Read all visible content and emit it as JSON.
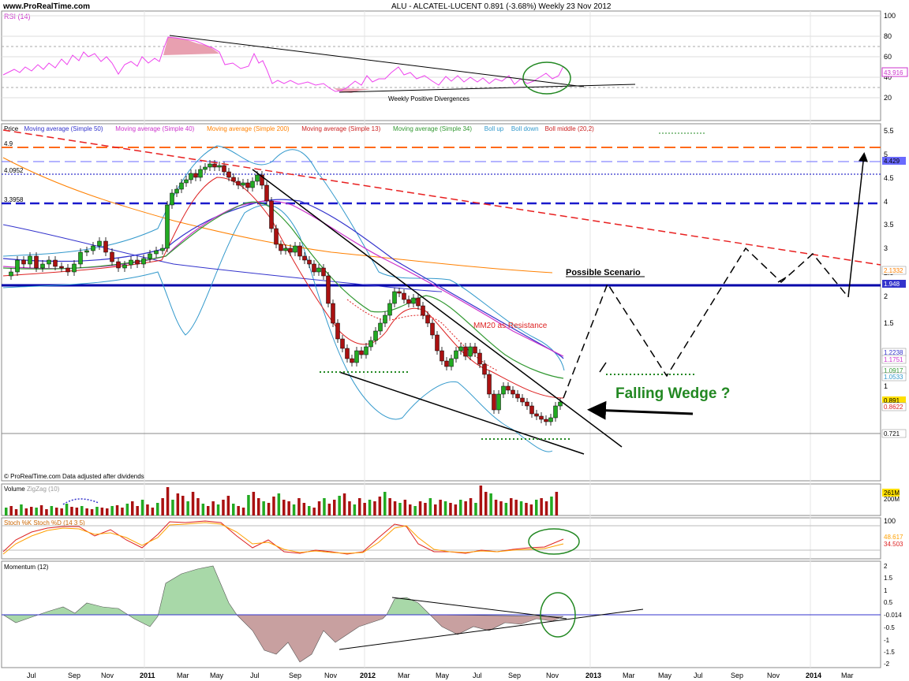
{
  "header": {
    "site": "www.ProRealTime.com",
    "title": "ALU - ALCATEL-LUCENT   0.891 (-3.68%)   Weekly  23 Nov 2012"
  },
  "panels": {
    "rsi": {
      "label": "RSI (14)",
      "ticks": [
        "100",
        "80",
        "60",
        "40",
        "20"
      ],
      "value_label": "43.916",
      "annotation": "Weekly Positive Divergences"
    },
    "price": {
      "legend": [
        {
          "text": "Price",
          "color": "#000000"
        },
        {
          "text": "Moving average (Simple 50)",
          "color": "#3333cc"
        },
        {
          "text": "Moving average (Simple 40)",
          "color": "#cc33cc"
        },
        {
          "text": "Moving average (Simple 200)",
          "color": "#ff8000"
        },
        {
          "text": "Moving average (Simple 13)",
          "color": "#cc2222"
        },
        {
          "text": "Moving average (Simple 34)",
          "color": "#339933"
        },
        {
          "text": "Boll up",
          "color": "#3399cc"
        },
        {
          "text": "Boll down",
          "color": "#3399cc"
        },
        {
          "text": "Boll middle (20,2)",
          "color": "#cc2222"
        }
      ],
      "ticks": [
        "5.5",
        "5",
        "4.5",
        "4",
        "3.5",
        "3",
        "2.5",
        "2",
        "1.5",
        "1"
      ],
      "levels": [
        "4.9",
        "4.0952",
        "3.3958"
      ],
      "right_labels": [
        "4.429",
        "2.1332",
        "1.948",
        "1.2238",
        "1.1751",
        "1.0917",
        "1.0533",
        "0.891",
        "0.8622",
        "0.721"
      ],
      "annotations": {
        "scenario": "Possible Scenario",
        "resistance": "MM20 as Resistance",
        "wedge": "Falling Wedge ?"
      },
      "footer": "© ProRealTime.com  Data adjusted after dividends"
    },
    "volume": {
      "label": "Volume",
      "zigzag": "ZigZag (10)",
      "ticks": [
        "261M",
        "200M"
      ]
    },
    "stoch": {
      "label": "Stoch %K Stoch %D (14 3 5)",
      "ticks": [
        "100"
      ],
      "value_labels": [
        "48.617",
        "34.503"
      ]
    },
    "momentum": {
      "label": "Momentum (12)",
      "ticks": [
        "2",
        "1.5",
        "1",
        "0.5",
        "0",
        "-0.5",
        "-1",
        "-1.5",
        "-2"
      ],
      "value_label": "-0.014"
    }
  },
  "x_axis": [
    "Jul",
    "Sep",
    "Nov",
    "2011",
    "Mar",
    "May",
    "Jul",
    "Sep",
    "Nov",
    "2012",
    "Mar",
    "May",
    "Jul",
    "Sep",
    "Nov",
    "2013",
    "Mar",
    "May",
    "Jul",
    "Sep",
    "Nov",
    "2014",
    "Mar"
  ],
  "chart_data": {
    "type": "candlestick",
    "title": "ALU - ALCATEL-LUCENT 0.891 (-3.68%) Weekly 23 Nov 2012",
    "ylim": [
      0.7,
      5.5
    ],
    "last_price": 0.891,
    "x": [
      "2010-07",
      "2010-08",
      "2010-09",
      "2010-10",
      "2010-11",
      "2010-12",
      "2011-01",
      "2011-02",
      "2011-03",
      "2011-04",
      "2011-05",
      "2011-06",
      "2011-07",
      "2011-08",
      "2011-09",
      "2011-10",
      "2011-11",
      "2011-12",
      "2012-01",
      "2012-02",
      "2012-03",
      "2012-04",
      "2012-05",
      "2012-06",
      "2012-07",
      "2012-08",
      "2012-09",
      "2012-10",
      "2012-11"
    ],
    "close": [
      2.2,
      2.35,
      2.45,
      2.6,
      2.25,
      2.3,
      2.4,
      2.6,
      3.9,
      4.05,
      4.3,
      4.1,
      3.8,
      3.2,
      2.3,
      2.0,
      1.25,
      1.15,
      1.15,
      1.45,
      1.9,
      1.75,
      1.2,
      1.3,
      1.0,
      0.95,
      0.92,
      0.86,
      0.891
    ],
    "series": [
      {
        "name": "Moving average (Simple 200)",
        "values": [
          3.7,
          3.55,
          3.4,
          3.25,
          3.1,
          2.95,
          2.85,
          2.8,
          2.8,
          2.85,
          2.95,
          3.05,
          3.05,
          2.95,
          2.75,
          2.6,
          2.45,
          2.4,
          2.35,
          2.3,
          2.3,
          2.25,
          2.2,
          2.18,
          2.16,
          2.15,
          2.14,
          2.135,
          2.1332
        ]
      },
      {
        "name": "Moving average (Simple 50)",
        "values": [
          2.4,
          2.35,
          2.3,
          2.3,
          2.3,
          2.35,
          2.45,
          2.7,
          2.9,
          3.1,
          3.35,
          3.5,
          3.55,
          3.5,
          3.3,
          3.0,
          2.7,
          2.45,
          2.2,
          2.0,
          1.9,
          1.8,
          1.7,
          1.55,
          1.45,
          1.35,
          1.3,
          1.25,
          1.2238
        ]
      }
    ],
    "stoch": {
      "k": 48.617,
      "d": 34.503
    },
    "momentum_last": -0.014,
    "rsi_last": 43.916
  }
}
